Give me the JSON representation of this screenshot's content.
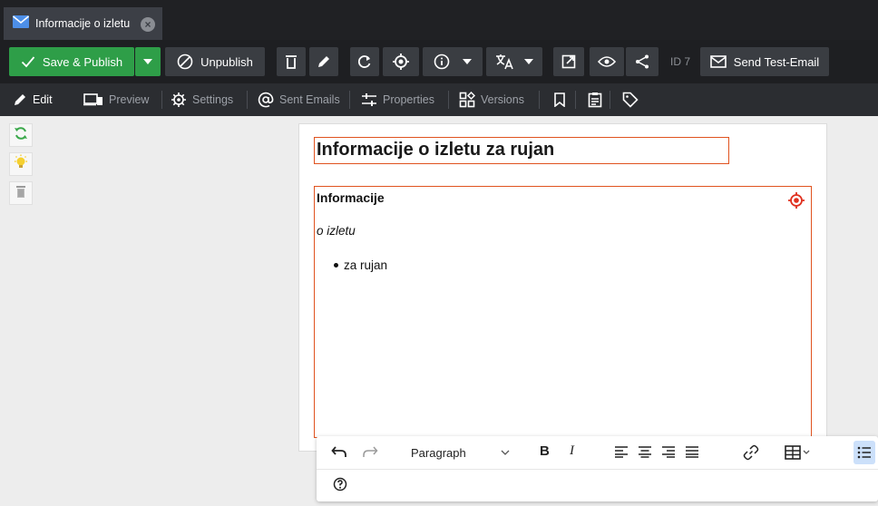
{
  "tab": {
    "title": "Informacije o izletu",
    "icon": "mail-icon",
    "close_icon": "close-icon"
  },
  "toolbar": {
    "save_publish_label": "Save & Publish",
    "unpublish_label": "Unpublish",
    "id_label": "ID 7",
    "send_test_email_label": "Send Test-Email",
    "accent_green": "#2e9e48"
  },
  "edit_tabs": [
    {
      "label": "Edit",
      "icon": "pencil-icon",
      "active": true
    },
    {
      "label": "Preview",
      "icon": "devices-icon"
    },
    {
      "label": "Settings",
      "icon": "gear-icon"
    },
    {
      "label": "Sent Emails",
      "icon": "at-icon"
    },
    {
      "label": "Properties",
      "icon": "sliders-icon"
    },
    {
      "label": "Versions",
      "icon": "versions-icon"
    }
  ],
  "document": {
    "title_value": "Informacije o izletu za rujan",
    "heading": "Informacije",
    "italic_line": "o izletu",
    "list_items": [
      "za rujan"
    ],
    "border_color": "#e0531f"
  },
  "editor_toolbar": {
    "block_style": "Paragraph"
  }
}
